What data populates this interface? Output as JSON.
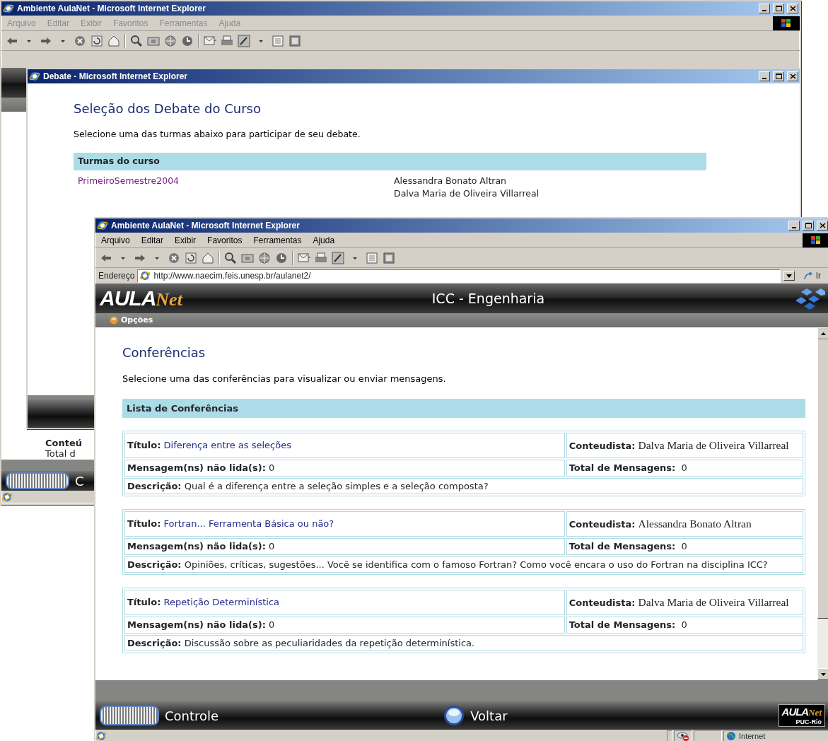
{
  "back_window": {
    "title": "Ambiente AulaNet - Microsoft Internet Explorer",
    "menu": [
      {
        "label": "Arquivo",
        "disabled": true
      },
      {
        "label": "Editar",
        "disabled": true
      },
      {
        "label": "Exibir",
        "disabled": true
      },
      {
        "label": "Favoritos",
        "disabled": true
      },
      {
        "label": "Ferramentas",
        "disabled": true
      },
      {
        "label": "Ajuda",
        "disabled": true
      }
    ],
    "fragments": [
      "Conteú",
      "Total d"
    ],
    "control": "C"
  },
  "debate_window": {
    "title": "Debate - Microsoft Internet Explorer",
    "heading": "Seleção dos Debate do Curso",
    "intro": "Selecione uma das turmas abaixo para participar de seu debate.",
    "table_header": "Turmas do curso",
    "classes": [
      {
        "name": "PrimeiroSemestre2004",
        "teachers": [
          "Alessandra Bonato Altran",
          "Dalva Maria de Oliveira Villarreal"
        ]
      }
    ]
  },
  "main_window": {
    "title": "Ambiente AulaNet - Microsoft Internet Explorer",
    "menu": [
      {
        "label": "Arquivo",
        "disabled": false
      },
      {
        "label": "Editar",
        "disabled": false
      },
      {
        "label": "Exibir",
        "disabled": false
      },
      {
        "label": "Favoritos",
        "disabled": false
      },
      {
        "label": "Ferramentas",
        "disabled": false
      },
      {
        "label": "Ajuda",
        "disabled": false
      }
    ],
    "address": {
      "label": "Endereço",
      "url": "http://www.naecim.feis.unesp.br/aulanet2/",
      "go": "Ir"
    },
    "header": {
      "logo": "AULA",
      "logo_script": "Net",
      "course": "ICC - Engenharia"
    },
    "options": "Opções",
    "page": {
      "title": "Conferências",
      "intro": "Selecione uma das conferências para visualizar ou enviar mensagens.",
      "list_header": "Lista de Conferências",
      "conferences": [
        {
          "title_label": "Título:",
          "title": "Diferença entre as seleções",
          "author_label": "Conteudista:",
          "author": "Dalva Maria de Oliveira Villarreal",
          "unread_label": "Mensagem(ns) não lida(s):",
          "unread": "0",
          "total_label": "Total de Mensagens:",
          "total": "0",
          "description_label": "Descrição:",
          "description": "Qual é a diferença entre a seleção simples e a seleção composta?"
        },
        {
          "title_label": "Título:",
          "title": "Fortran... Ferramenta Básica ou não?",
          "author_label": "Conteudista:",
          "author": "Alessandra Bonato Altran",
          "unread_label": "Mensagem(ns) não lida(s):",
          "unread": "0",
          "total_label": "Total de Mensagens:",
          "total": "0",
          "description_label": "Descrição:",
          "description": "Opiniões, críticas, sugestões... Você se identifica com o famoso Fortran? Como você encara o uso do Fortran na disciplina ICC?"
        },
        {
          "title_label": "Título:",
          "title": "Repetição Determinística",
          "author_label": "Conteudista:",
          "author": "Dalva Maria de Oliveira Villarreal",
          "unread_label": "Mensagem(ns) não lida(s):",
          "unread": "0",
          "total_label": "Total de Mensagens:",
          "total": "0",
          "description_label": "Descrição:",
          "description": "Discussão sobre as peculiaridades da repetição determinística."
        }
      ]
    },
    "footer": {
      "control": "Controle",
      "back": "Voltar",
      "logo": "AULA",
      "logo_script": "Net",
      "logo_caption": "PUC-Rio"
    },
    "status": {
      "zone": "Internet"
    }
  }
}
